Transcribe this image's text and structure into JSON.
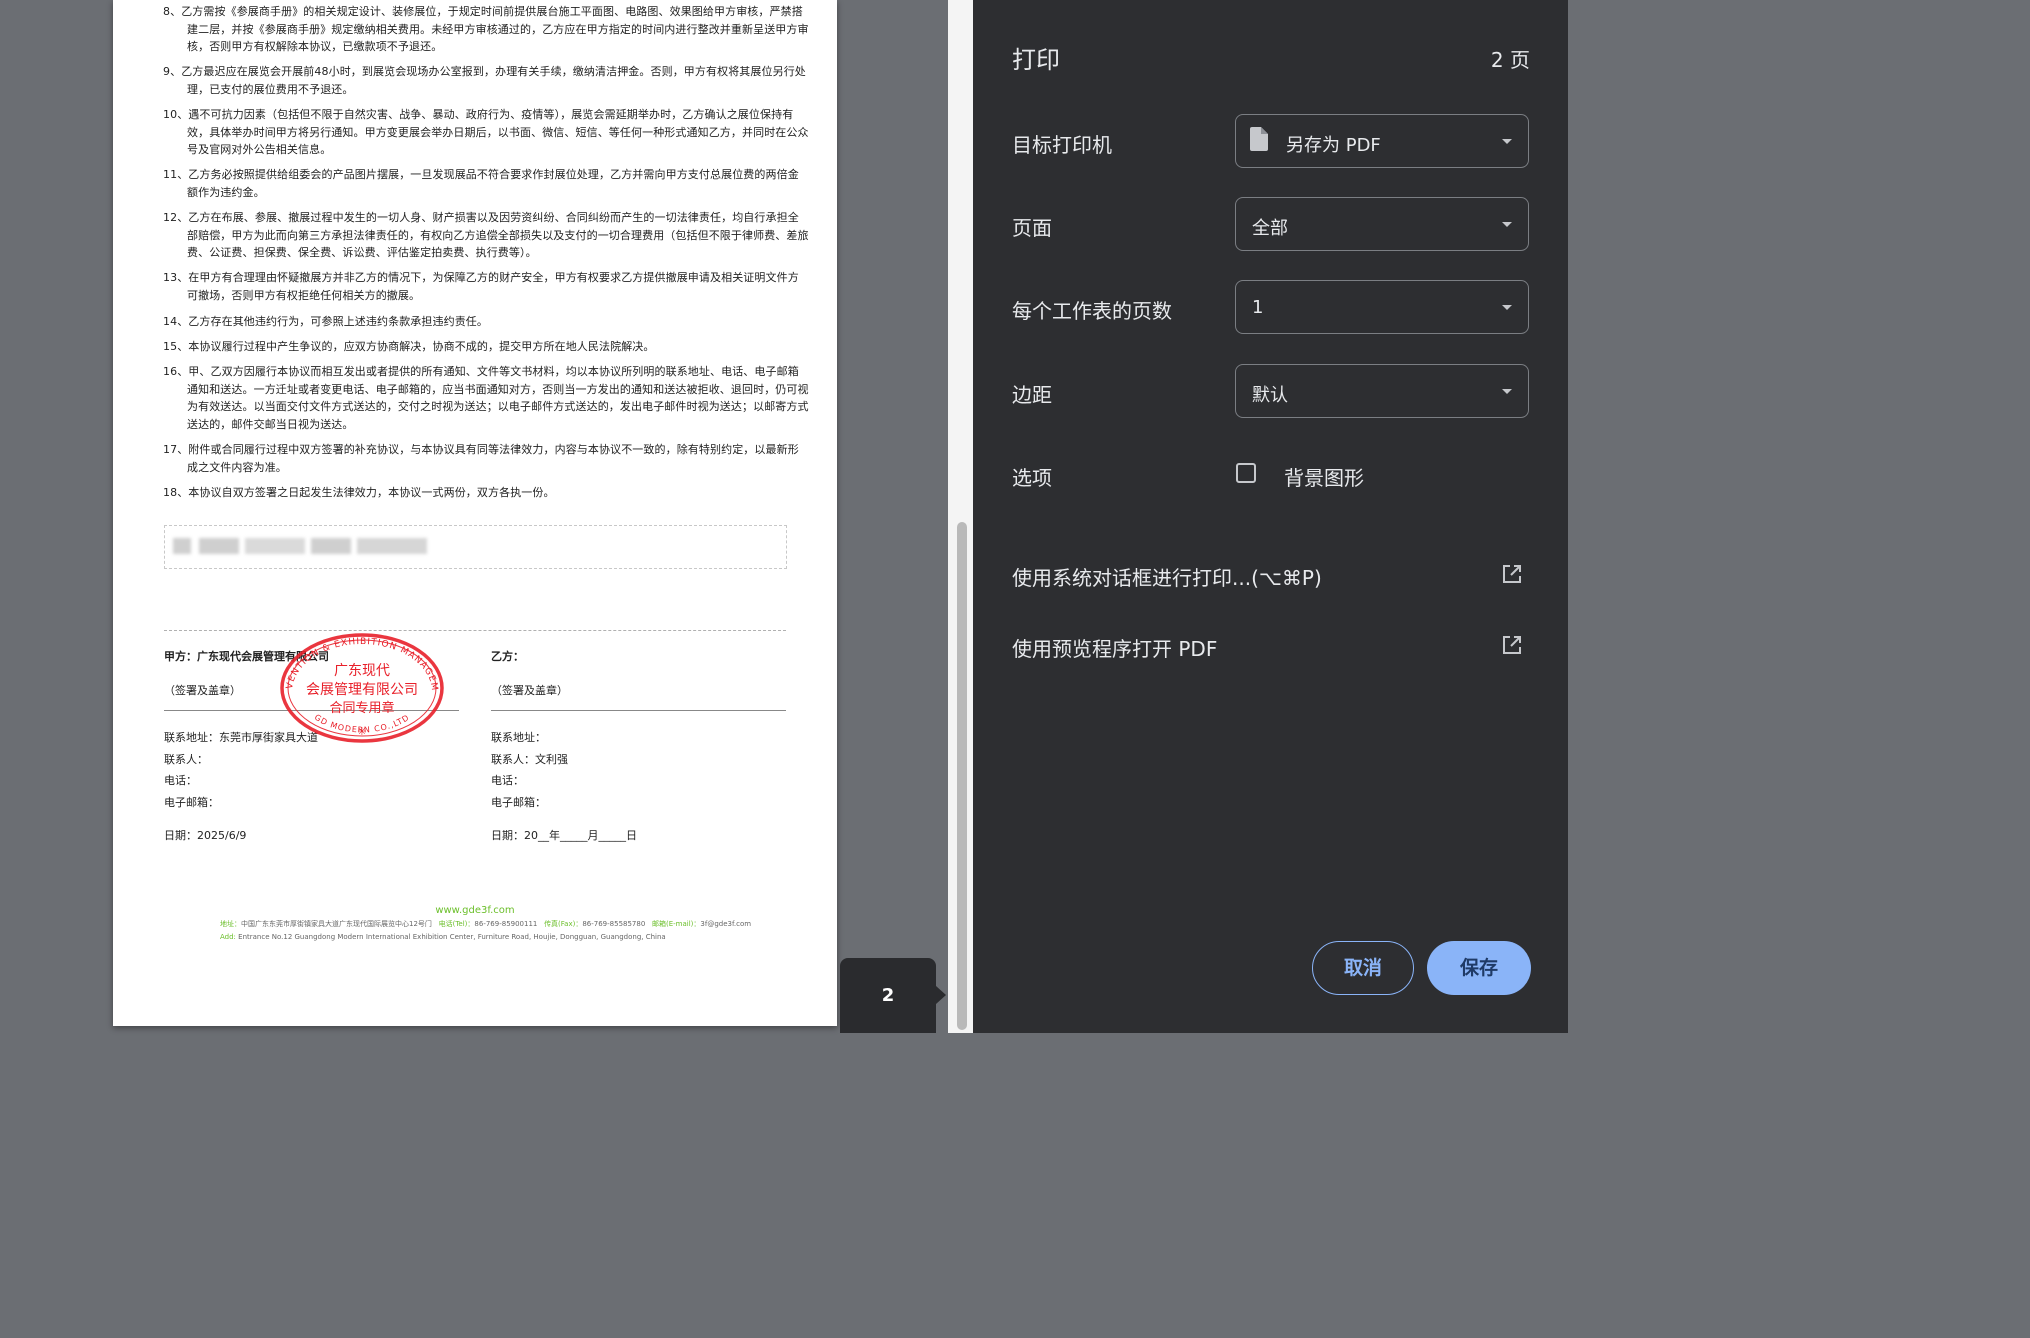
{
  "document": {
    "clauses": [
      "8、乙方需按《参展商手册》的相关规定设计、装修展位，于规定时间前提供展台施工平面图、电路图、效果图给甲方审核，严禁搭建二层，并按《参展商手册》规定缴纳相关费用。未经甲方审核通过的，乙方应在甲方指定的时间内进行整改并重新呈送甲方审核，否则甲方有权解除本协议，已缴款项不予退还。",
      "9、乙方最迟应在展览会开展前48小时，到展览会现场办公室报到，办理有关手续，缴纳清洁押金。否则，甲方有权将其展位另行处理，已支付的展位费用不予退还。",
      "10、遇不可抗力因素（包括但不限于自然灾害、战争、暴动、政府行为、疫情等），展览会需延期举办时，乙方确认之展位保持有效，具体举办时间甲方将另行通知。甲方变更展会举办日期后，以书面、微信、短信、等任何一种形式通知乙方，并同时在公众号及官网对外公告相关信息。",
      "11、乙方务必按照提供给组委会的产品图片摆展，一旦发现展品不符合要求作封展位处理，乙方并需向甲方支付总展位费的两倍金额作为违约金。",
      "12、乙方在布展、参展、撤展过程中发生的一切人身、财产损害以及因劳资纠纷、合同纠纷而产生的一切法律责任，均自行承担全部赔偿，甲方为此而向第三方承担法律责任的，有权向乙方追偿全部损失以及支付的一切合理费用（包括但不限于律师费、差旅费、公证费、担保费、保全费、诉讼费、评估鉴定拍卖费、执行费等）。",
      "13、在甲方有合理理由怀疑撤展方并非乙方的情况下，为保障乙方的财产安全，甲方有权要求乙方提供撤展申请及相关证明文件方可撤场，否则甲方有权拒绝任何相关方的撤展。",
      "14、乙方存在其他违约行为，可参照上述违约条款承担违约责任。",
      "15、本协议履行过程中产生争议的，应双方协商解决，协商不成的，提交甲方所在地人民法院解决。",
      "16、甲、乙双方因履行本协议而相互发出或者提供的所有通知、文件等文书材料，均以本协议所列明的联系地址、电话、电子邮箱通知和送达。一方迁址或者变更电话、电子邮箱的，应当书面通知对方，否则当一方发出的通知和送达被拒收、退回时，仍可视为有效送达。以当面交付文件方式送达的，交付之时视为送达；以电子邮件方式送达的，发出电子邮件时视为送达；以邮寄方式送达的，邮件交邮当日视为送达。",
      "17、附件或合同履行过程中双方签署的补充协议，与本协议具有同等法律效力，内容与本协议不一致的，除有特别约定，以最新形成之文件内容为准。",
      "18、本协议自双方签署之日起发生法律效力，本协议一式两份，双方各执一份。"
    ],
    "party_a": {
      "name": "甲方：广东现代会展管理有限公司",
      "sign": "（签署及盖章）",
      "address": "联系地址：东莞市厚街家具大道",
      "contact": "联系人：",
      "phone": "电话：",
      "email": "电子邮箱：",
      "date": "日期：2025/6/9"
    },
    "party_b": {
      "name": "乙方：",
      "sign": "（签署及盖章）",
      "address": "联系地址：",
      "contact": "联系人：文利强",
      "phone": "电话：",
      "email": "电子邮箱：",
      "date": "日期：20__年_____月_____日"
    },
    "seal": {
      "top_arc": "CONVENTION & EXHIBITION MANAGEMENT",
      "bottom_arc": "GD MODERN  CO.,LTD",
      "line1": "广东现代",
      "line2": "会展管理有限公司",
      "line3": "合同专用章",
      "star": "✳"
    },
    "footer": {
      "url": "www.gde3f.com",
      "addr_label": "地址：",
      "addr": "中国广东东莞市厚街镇家具大道广东现代国际展览中心12号门",
      "tel_label": "电话(Tel)：",
      "tel": "86-769-85900111",
      "fax_label": "传真(Fax)：",
      "fax": "86-769-85585780",
      "email_label": "邮箱(E-mail)：",
      "email": "3f@gde3f.com",
      "add_label": "Add:",
      "add_en": "Entrance No.12 Guangdong Modern International Exhibition Center, Furniture Road, Houjie, Dongguan, Guangdong, China"
    }
  },
  "preview": {
    "page_number": "2"
  },
  "panel": {
    "title": "打印",
    "page_count": "2 页",
    "destination": {
      "label": "目标打印机",
      "value": "另存为 PDF"
    },
    "pages": {
      "label": "页面",
      "value": "全部"
    },
    "pages_per_sheet": {
      "label": "每个工作表的页数",
      "value": "1"
    },
    "margins": {
      "label": "边距",
      "value": "默认"
    },
    "options": {
      "label": "选项",
      "checkbox_label": "背景图形",
      "checked": false
    },
    "system_dialog": "使用系统对话框进行打印...(⌥⌘P)",
    "open_preview": "使用预览程序打开 PDF",
    "cancel": "取消",
    "save": "保存"
  },
  "colors": {
    "panel_bg": "#2d2e31",
    "accent": "#8ab4f8",
    "seal_red": "#e8202a",
    "footer_green": "#6bbf2a"
  }
}
